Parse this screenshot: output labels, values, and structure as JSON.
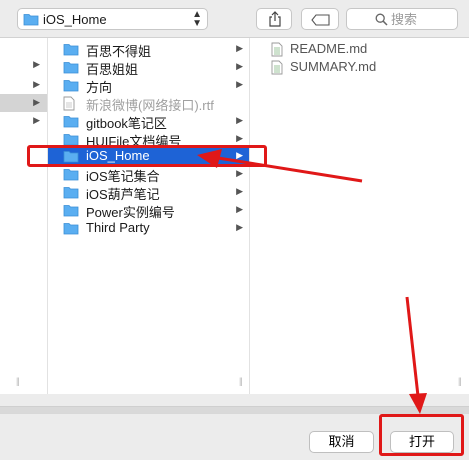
{
  "toolbar": {
    "path_label": "iOS_Home",
    "search_placeholder": "搜索"
  },
  "column2": {
    "items": [
      {
        "name": "百思不得姐",
        "type": "folder",
        "has_children": true
      },
      {
        "name": "百思姐姐",
        "type": "folder",
        "has_children": true
      },
      {
        "name": "方向",
        "type": "folder",
        "has_children": true
      },
      {
        "name": "新浪微博(网络接口).rtf",
        "type": "file",
        "has_children": false
      },
      {
        "name": "gitbook笔记区",
        "type": "folder",
        "has_children": true
      },
      {
        "name": "HUIFile文档编号",
        "type": "folder",
        "has_children": true
      },
      {
        "name": "iOS_Home",
        "type": "folder",
        "has_children": true,
        "selected": true
      },
      {
        "name": "iOS笔记集合",
        "type": "folder",
        "has_children": true
      },
      {
        "name": "iOS葫芦笔记",
        "type": "folder",
        "has_children": true
      },
      {
        "name": "Power实例编号",
        "type": "folder",
        "has_children": true
      },
      {
        "name": "Third Party",
        "type": "folder",
        "has_children": true
      }
    ]
  },
  "column3": {
    "items": [
      {
        "name": "README.md",
        "type": "file"
      },
      {
        "name": "SUMMARY.md",
        "type": "file"
      }
    ]
  },
  "buttons": {
    "cancel": "取消",
    "open": "打开"
  },
  "colors": {
    "selection": "#1e63d6",
    "folder": "#5aaef1",
    "annotation": "#e01818"
  }
}
